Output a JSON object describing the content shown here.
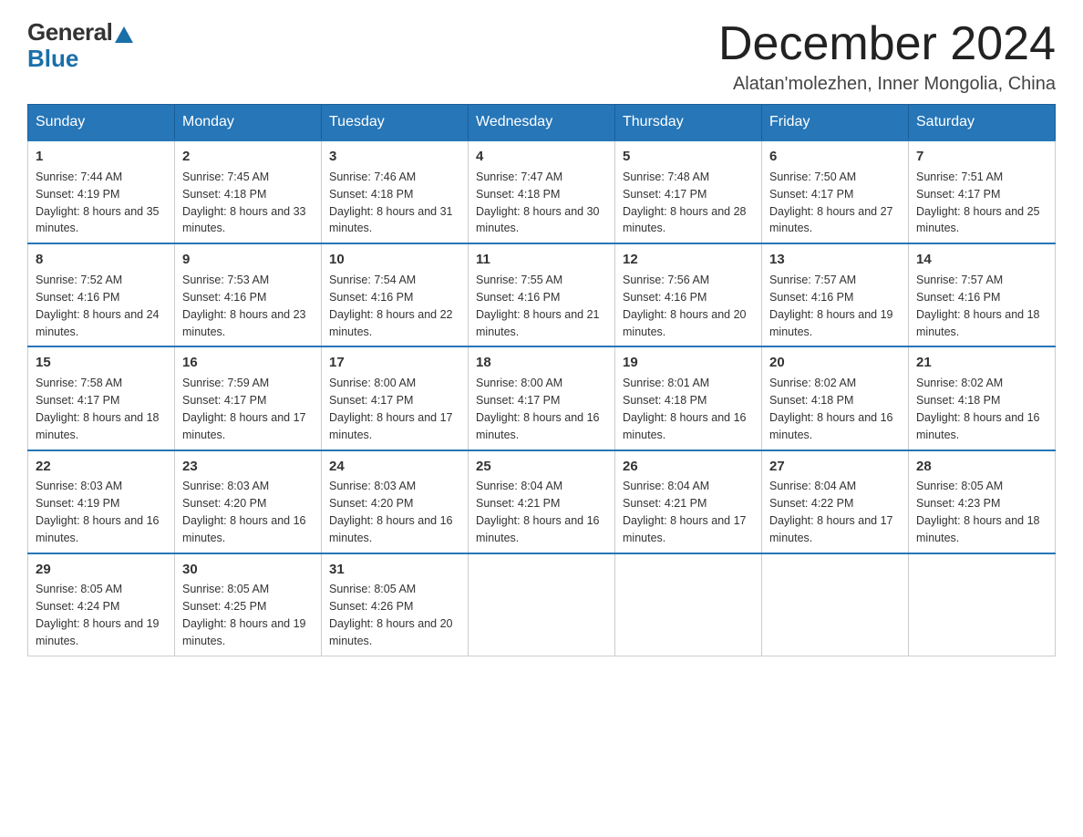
{
  "logo": {
    "general": "General",
    "blue": "Blue"
  },
  "title": "December 2024",
  "location": "Alatan'molezhen, Inner Mongolia, China",
  "weekdays": [
    "Sunday",
    "Monday",
    "Tuesday",
    "Wednesday",
    "Thursday",
    "Friday",
    "Saturday"
  ],
  "weeks": [
    [
      {
        "day": "1",
        "sunrise": "7:44 AM",
        "sunset": "4:19 PM",
        "daylight": "8 hours and 35 minutes."
      },
      {
        "day": "2",
        "sunrise": "7:45 AM",
        "sunset": "4:18 PM",
        "daylight": "8 hours and 33 minutes."
      },
      {
        "day": "3",
        "sunrise": "7:46 AM",
        "sunset": "4:18 PM",
        "daylight": "8 hours and 31 minutes."
      },
      {
        "day": "4",
        "sunrise": "7:47 AM",
        "sunset": "4:18 PM",
        "daylight": "8 hours and 30 minutes."
      },
      {
        "day": "5",
        "sunrise": "7:48 AM",
        "sunset": "4:17 PM",
        "daylight": "8 hours and 28 minutes."
      },
      {
        "day": "6",
        "sunrise": "7:50 AM",
        "sunset": "4:17 PM",
        "daylight": "8 hours and 27 minutes."
      },
      {
        "day": "7",
        "sunrise": "7:51 AM",
        "sunset": "4:17 PM",
        "daylight": "8 hours and 25 minutes."
      }
    ],
    [
      {
        "day": "8",
        "sunrise": "7:52 AM",
        "sunset": "4:16 PM",
        "daylight": "8 hours and 24 minutes."
      },
      {
        "day": "9",
        "sunrise": "7:53 AM",
        "sunset": "4:16 PM",
        "daylight": "8 hours and 23 minutes."
      },
      {
        "day": "10",
        "sunrise": "7:54 AM",
        "sunset": "4:16 PM",
        "daylight": "8 hours and 22 minutes."
      },
      {
        "day": "11",
        "sunrise": "7:55 AM",
        "sunset": "4:16 PM",
        "daylight": "8 hours and 21 minutes."
      },
      {
        "day": "12",
        "sunrise": "7:56 AM",
        "sunset": "4:16 PM",
        "daylight": "8 hours and 20 minutes."
      },
      {
        "day": "13",
        "sunrise": "7:57 AM",
        "sunset": "4:16 PM",
        "daylight": "8 hours and 19 minutes."
      },
      {
        "day": "14",
        "sunrise": "7:57 AM",
        "sunset": "4:16 PM",
        "daylight": "8 hours and 18 minutes."
      }
    ],
    [
      {
        "day": "15",
        "sunrise": "7:58 AM",
        "sunset": "4:17 PM",
        "daylight": "8 hours and 18 minutes."
      },
      {
        "day": "16",
        "sunrise": "7:59 AM",
        "sunset": "4:17 PM",
        "daylight": "8 hours and 17 minutes."
      },
      {
        "day": "17",
        "sunrise": "8:00 AM",
        "sunset": "4:17 PM",
        "daylight": "8 hours and 17 minutes."
      },
      {
        "day": "18",
        "sunrise": "8:00 AM",
        "sunset": "4:17 PM",
        "daylight": "8 hours and 16 minutes."
      },
      {
        "day": "19",
        "sunrise": "8:01 AM",
        "sunset": "4:18 PM",
        "daylight": "8 hours and 16 minutes."
      },
      {
        "day": "20",
        "sunrise": "8:02 AM",
        "sunset": "4:18 PM",
        "daylight": "8 hours and 16 minutes."
      },
      {
        "day": "21",
        "sunrise": "8:02 AM",
        "sunset": "4:18 PM",
        "daylight": "8 hours and 16 minutes."
      }
    ],
    [
      {
        "day": "22",
        "sunrise": "8:03 AM",
        "sunset": "4:19 PM",
        "daylight": "8 hours and 16 minutes."
      },
      {
        "day": "23",
        "sunrise": "8:03 AM",
        "sunset": "4:20 PM",
        "daylight": "8 hours and 16 minutes."
      },
      {
        "day": "24",
        "sunrise": "8:03 AM",
        "sunset": "4:20 PM",
        "daylight": "8 hours and 16 minutes."
      },
      {
        "day": "25",
        "sunrise": "8:04 AM",
        "sunset": "4:21 PM",
        "daylight": "8 hours and 16 minutes."
      },
      {
        "day": "26",
        "sunrise": "8:04 AM",
        "sunset": "4:21 PM",
        "daylight": "8 hours and 17 minutes."
      },
      {
        "day": "27",
        "sunrise": "8:04 AM",
        "sunset": "4:22 PM",
        "daylight": "8 hours and 17 minutes."
      },
      {
        "day": "28",
        "sunrise": "8:05 AM",
        "sunset": "4:23 PM",
        "daylight": "8 hours and 18 minutes."
      }
    ],
    [
      {
        "day": "29",
        "sunrise": "8:05 AM",
        "sunset": "4:24 PM",
        "daylight": "8 hours and 19 minutes."
      },
      {
        "day": "30",
        "sunrise": "8:05 AM",
        "sunset": "4:25 PM",
        "daylight": "8 hours and 19 minutes."
      },
      {
        "day": "31",
        "sunrise": "8:05 AM",
        "sunset": "4:26 PM",
        "daylight": "8 hours and 20 minutes."
      },
      null,
      null,
      null,
      null
    ]
  ]
}
